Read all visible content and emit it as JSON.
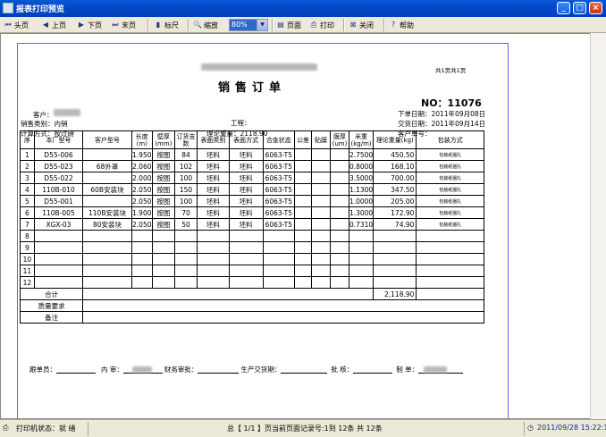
{
  "window": {
    "title": "报表打印预览",
    "min": "_",
    "max": "□",
    "close": "×"
  },
  "toolbar": {
    "first": "头页",
    "prev": "上页",
    "next": "下页",
    "last": "末页",
    "ruler": "标尺",
    "zoom_label": "缩放",
    "zoom_value": "80%",
    "page_setup": "页面",
    "print": "打印",
    "close": "关闭",
    "help": "帮助"
  },
  "report": {
    "page_indicator": "共1页共1页",
    "doc_title": "销售订单",
    "order_no": "NO：11076",
    "customer_label": "客户：",
    "sales_category": "销售类别：内销",
    "calc_method": "计算方式：按过磅",
    "project_label": "工程：",
    "theory_weight": "理论重量：2118.90",
    "order_date": "下单日期：2011年09月08日",
    "delivery_date": "交货日期：2011年09月14日",
    "customer_order_no": "客户单号：",
    "headers": [
      "序",
      "本厂型号",
      "客户型号",
      "长度(m)",
      "壁厚(mm)",
      "订货支数",
      "表面类别",
      "表面方式",
      "合金状态",
      "公差",
      "贴膜",
      "膜厚(um)",
      "米重(kg/m)",
      "理论重量(kg)",
      "包装方式"
    ],
    "rows": [
      [
        "1",
        "D55-006",
        "",
        "1.950",
        "按图",
        "84",
        "坯料",
        "坯料",
        "6063-T5",
        "",
        "",
        "",
        "2.7500",
        "450.50",
        "包装纸捆扎"
      ],
      [
        "2",
        "D55-023",
        "68外罩",
        "2.060",
        "按图",
        "102",
        "坯料",
        "坯料",
        "6063-T5",
        "",
        "",
        "",
        "0.8000",
        "168.10",
        "包装纸捆扎"
      ],
      [
        "3",
        "D55-022",
        "",
        "2.000",
        "按图",
        "100",
        "坯料",
        "坯料",
        "6063-T5",
        "",
        "",
        "",
        "3.5000",
        "700.00",
        "包装纸捆扎"
      ],
      [
        "4",
        "110B-010",
        "60B安装块",
        "2.050",
        "按图",
        "150",
        "坯料",
        "坯料",
        "6063-T5",
        "",
        "",
        "",
        "1.1300",
        "347.50",
        "包装纸捆扎"
      ],
      [
        "5",
        "D55-001",
        "",
        "2.050",
        "按图",
        "100",
        "坯料",
        "坯料",
        "6063-T5",
        "",
        "",
        "",
        "1.0000",
        "205.00",
        "包装纸捆扎"
      ],
      [
        "6",
        "110B-005",
        "110B安装块",
        "1.900",
        "按图",
        "70",
        "坯料",
        "坯料",
        "6063-T5",
        "",
        "",
        "",
        "1.3000",
        "172.90",
        "包装纸捆扎"
      ],
      [
        "7",
        "XGX-03",
        "80安装块",
        "2.050",
        "按图",
        "50",
        "坯料",
        "坯料",
        "6063-T5",
        "",
        "",
        "",
        "0.7310",
        "74.90",
        "包装纸捆扎"
      ],
      [
        "8",
        "",
        "",
        "",
        "",
        "",
        "",
        "",
        "",
        "",
        "",
        "",
        "",
        "",
        ""
      ],
      [
        "9",
        "",
        "",
        "",
        "",
        "",
        "",
        "",
        "",
        "",
        "",
        "",
        "",
        "",
        ""
      ],
      [
        "10",
        "",
        "",
        "",
        "",
        "",
        "",
        "",
        "",
        "",
        "",
        "",
        "",
        "",
        ""
      ],
      [
        "11",
        "",
        "",
        "",
        "",
        "",
        "",
        "",
        "",
        "",
        "",
        "",
        "",
        "",
        ""
      ],
      [
        "12",
        "",
        "",
        "",
        "",
        "",
        "",
        "",
        "",
        "",
        "",
        "",
        "",
        "",
        ""
      ]
    ],
    "total_label": "合计",
    "total_value": "2,118.90",
    "quality_label": "质量要求",
    "remark_label": "备注",
    "footer": {
      "follow_label": "跟单员：",
      "internal_audit_label": "内 审：",
      "finance_label": "财务审批：",
      "production_label": "生产交货期：",
      "approve_label": "批 核：",
      "maker_label": "制 单："
    }
  },
  "status": {
    "printer": "打印机状态：就 绪",
    "pages": "总【 1/1 】页当前页面记录号:1到 12条  共 12条",
    "datetime": "2011/09/28 15:22:16"
  },
  "colors": {
    "titlebar": "#0040b8",
    "chrome": "#ece9d8",
    "page_border": "#6464ff"
  }
}
